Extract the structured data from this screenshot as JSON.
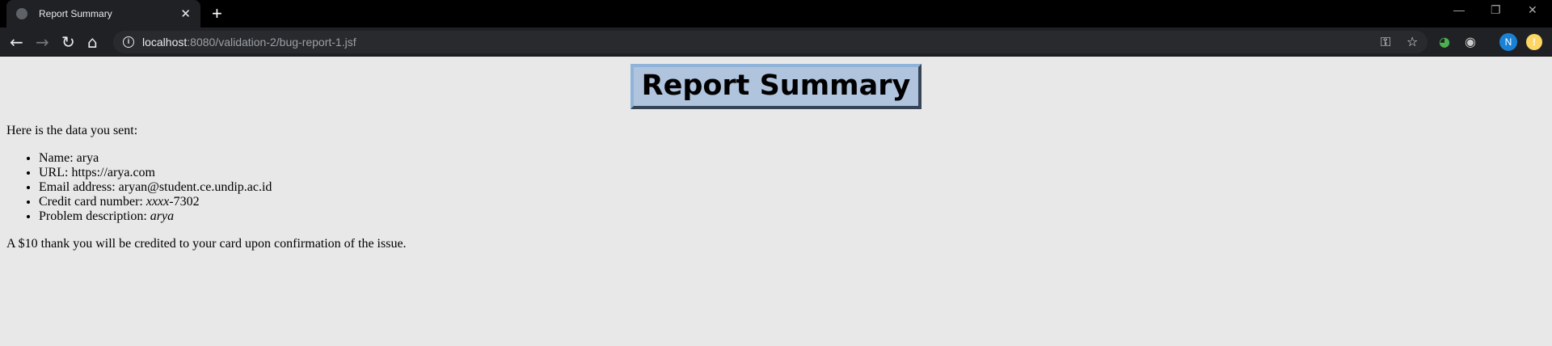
{
  "browser": {
    "tab_title": "Report Summary",
    "url_host": "localhost",
    "url_rest": ":8080/validation-2/bug-report-1.jsf",
    "profile_initial": "N"
  },
  "page": {
    "heading": "Report Summary",
    "intro": "Here is the data you sent:",
    "items": [
      {
        "label": "Name: ",
        "value": "arya",
        "italic": false
      },
      {
        "label": "URL: ",
        "value": "https://arya.com",
        "italic": false
      },
      {
        "label": "Email address: ",
        "value": "aryan@student.ce.undip.ac.id",
        "italic": false
      },
      {
        "label": "Credit card number: ",
        "value_italic": "xxxx",
        "value": "-7302"
      },
      {
        "label": "Problem description: ",
        "value_italic": "arya"
      }
    ],
    "closing": "A $10 thank you will be credited to your card upon confirmation of the issue."
  }
}
